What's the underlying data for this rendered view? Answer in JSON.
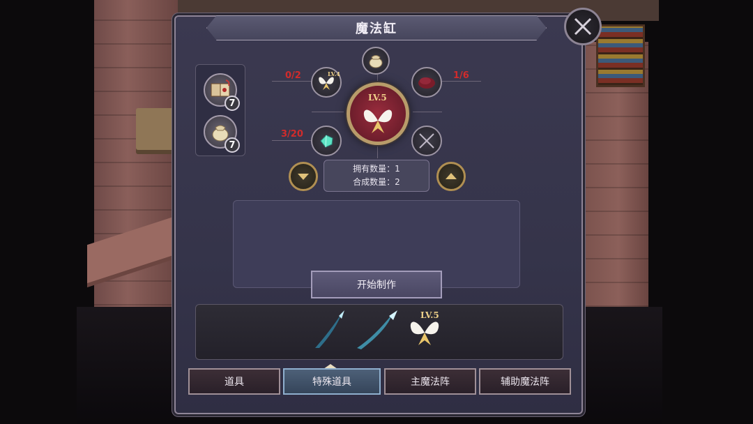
{
  "window": {
    "title": "魔法缸"
  },
  "materials": [
    {
      "icon": "spellbook-icon",
      "count": "7"
    },
    {
      "icon": "pouch-icon",
      "count": "7"
    }
  ],
  "wheel": {
    "top_left": {
      "icon": "fairy-wings-icon",
      "level": "LV.4",
      "fraction": "0/2"
    },
    "top": {
      "icon": "pouch-icon"
    },
    "top_right": {
      "icon": "beret-icon",
      "fraction": "1/6"
    },
    "bottom_left": {
      "icon": "crystal-gem-icon",
      "fraction": "3/20"
    },
    "bottom_right": {
      "icon": "empty-slot-icon"
    },
    "center": {
      "icon": "fairy-wings-icon",
      "level": "LV.5"
    }
  },
  "info": {
    "owned": "拥有数量：1",
    "craft": "合成数量：2"
  },
  "craft_button": "开始制作",
  "preview": {
    "items": [
      "blade-icon",
      "blade-icon",
      "fairy-wings-icon"
    ],
    "level": "LV.5"
  },
  "tabs": [
    {
      "label": "道具",
      "active": false
    },
    {
      "label": "特殊道具",
      "active": true
    },
    {
      "label": "主魔法阵",
      "active": false
    },
    {
      "label": "辅助魔法阵",
      "active": false
    }
  ],
  "colors": {
    "fraction_red": "#d22b2b",
    "accent_gold": "#b08f52",
    "active_tab": "#4d6078"
  }
}
